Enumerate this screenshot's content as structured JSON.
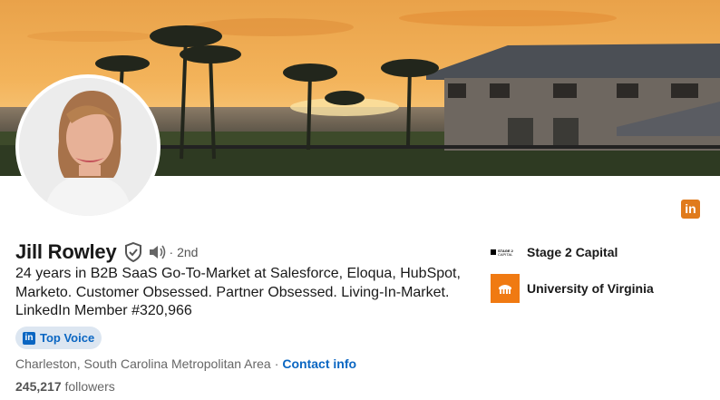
{
  "profile": {
    "name": "Jill Rowley",
    "degree": "· 2nd",
    "headline": "24 years in B2B SaaS Go-To-Market at Salesforce, Eloqua, HubSpot, Marketo. Customer Obsessed. Partner Obsessed. Living-In-Market. LinkedIn Member #320,966",
    "badge": "Top Voice",
    "location": "Charleston, South Carolina Metropolitan Area",
    "separator": "·",
    "contact_label": "Contact info",
    "followers_count": "245,217",
    "followers_label": "followers"
  },
  "experience": [
    {
      "name": "Stage 2 Capital",
      "logo_text": "STAGE 2 CAPITAL"
    },
    {
      "name": "University of Virginia"
    }
  ],
  "icons": {
    "verified": "verified-shield-icon",
    "pronunciation": "speaker-icon",
    "linkedin": "linkedin-icon"
  },
  "colors": {
    "link": "#0a66c2",
    "badge_bg": "#dce6f1",
    "uva_orange": "#f07a12"
  }
}
